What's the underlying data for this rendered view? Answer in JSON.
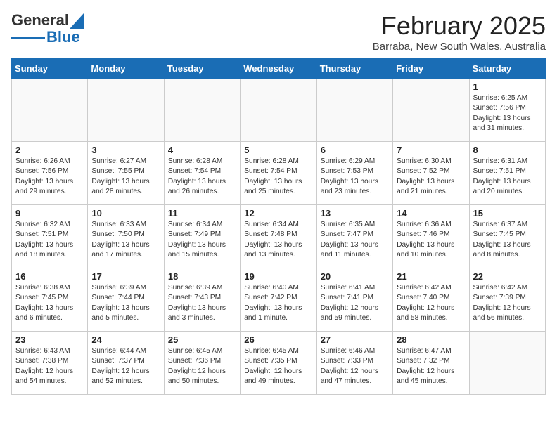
{
  "logo": {
    "text1": "General",
    "text2": "Blue"
  },
  "title": "February 2025",
  "subtitle": "Barraba, New South Wales, Australia",
  "weekdays": [
    "Sunday",
    "Monday",
    "Tuesday",
    "Wednesday",
    "Thursday",
    "Friday",
    "Saturday"
  ],
  "weeks": [
    [
      {
        "day": "",
        "info": ""
      },
      {
        "day": "",
        "info": ""
      },
      {
        "day": "",
        "info": ""
      },
      {
        "day": "",
        "info": ""
      },
      {
        "day": "",
        "info": ""
      },
      {
        "day": "",
        "info": ""
      },
      {
        "day": "1",
        "info": "Sunrise: 6:25 AM\nSunset: 7:56 PM\nDaylight: 13 hours and 31 minutes."
      }
    ],
    [
      {
        "day": "2",
        "info": "Sunrise: 6:26 AM\nSunset: 7:56 PM\nDaylight: 13 hours and 29 minutes."
      },
      {
        "day": "3",
        "info": "Sunrise: 6:27 AM\nSunset: 7:55 PM\nDaylight: 13 hours and 28 minutes."
      },
      {
        "day": "4",
        "info": "Sunrise: 6:28 AM\nSunset: 7:54 PM\nDaylight: 13 hours and 26 minutes."
      },
      {
        "day": "5",
        "info": "Sunrise: 6:28 AM\nSunset: 7:54 PM\nDaylight: 13 hours and 25 minutes."
      },
      {
        "day": "6",
        "info": "Sunrise: 6:29 AM\nSunset: 7:53 PM\nDaylight: 13 hours and 23 minutes."
      },
      {
        "day": "7",
        "info": "Sunrise: 6:30 AM\nSunset: 7:52 PM\nDaylight: 13 hours and 21 minutes."
      },
      {
        "day": "8",
        "info": "Sunrise: 6:31 AM\nSunset: 7:51 PM\nDaylight: 13 hours and 20 minutes."
      }
    ],
    [
      {
        "day": "9",
        "info": "Sunrise: 6:32 AM\nSunset: 7:51 PM\nDaylight: 13 hours and 18 minutes."
      },
      {
        "day": "10",
        "info": "Sunrise: 6:33 AM\nSunset: 7:50 PM\nDaylight: 13 hours and 17 minutes."
      },
      {
        "day": "11",
        "info": "Sunrise: 6:34 AM\nSunset: 7:49 PM\nDaylight: 13 hours and 15 minutes."
      },
      {
        "day": "12",
        "info": "Sunrise: 6:34 AM\nSunset: 7:48 PM\nDaylight: 13 hours and 13 minutes."
      },
      {
        "day": "13",
        "info": "Sunrise: 6:35 AM\nSunset: 7:47 PM\nDaylight: 13 hours and 11 minutes."
      },
      {
        "day": "14",
        "info": "Sunrise: 6:36 AM\nSunset: 7:46 PM\nDaylight: 13 hours and 10 minutes."
      },
      {
        "day": "15",
        "info": "Sunrise: 6:37 AM\nSunset: 7:45 PM\nDaylight: 13 hours and 8 minutes."
      }
    ],
    [
      {
        "day": "16",
        "info": "Sunrise: 6:38 AM\nSunset: 7:45 PM\nDaylight: 13 hours and 6 minutes."
      },
      {
        "day": "17",
        "info": "Sunrise: 6:39 AM\nSunset: 7:44 PM\nDaylight: 13 hours and 5 minutes."
      },
      {
        "day": "18",
        "info": "Sunrise: 6:39 AM\nSunset: 7:43 PM\nDaylight: 13 hours and 3 minutes."
      },
      {
        "day": "19",
        "info": "Sunrise: 6:40 AM\nSunset: 7:42 PM\nDaylight: 13 hours and 1 minute."
      },
      {
        "day": "20",
        "info": "Sunrise: 6:41 AM\nSunset: 7:41 PM\nDaylight: 12 hours and 59 minutes."
      },
      {
        "day": "21",
        "info": "Sunrise: 6:42 AM\nSunset: 7:40 PM\nDaylight: 12 hours and 58 minutes."
      },
      {
        "day": "22",
        "info": "Sunrise: 6:42 AM\nSunset: 7:39 PM\nDaylight: 12 hours and 56 minutes."
      }
    ],
    [
      {
        "day": "23",
        "info": "Sunrise: 6:43 AM\nSunset: 7:38 PM\nDaylight: 12 hours and 54 minutes."
      },
      {
        "day": "24",
        "info": "Sunrise: 6:44 AM\nSunset: 7:37 PM\nDaylight: 12 hours and 52 minutes."
      },
      {
        "day": "25",
        "info": "Sunrise: 6:45 AM\nSunset: 7:36 PM\nDaylight: 12 hours and 50 minutes."
      },
      {
        "day": "26",
        "info": "Sunrise: 6:45 AM\nSunset: 7:35 PM\nDaylight: 12 hours and 49 minutes."
      },
      {
        "day": "27",
        "info": "Sunrise: 6:46 AM\nSunset: 7:33 PM\nDaylight: 12 hours and 47 minutes."
      },
      {
        "day": "28",
        "info": "Sunrise: 6:47 AM\nSunset: 7:32 PM\nDaylight: 12 hours and 45 minutes."
      },
      {
        "day": "",
        "info": ""
      }
    ]
  ]
}
